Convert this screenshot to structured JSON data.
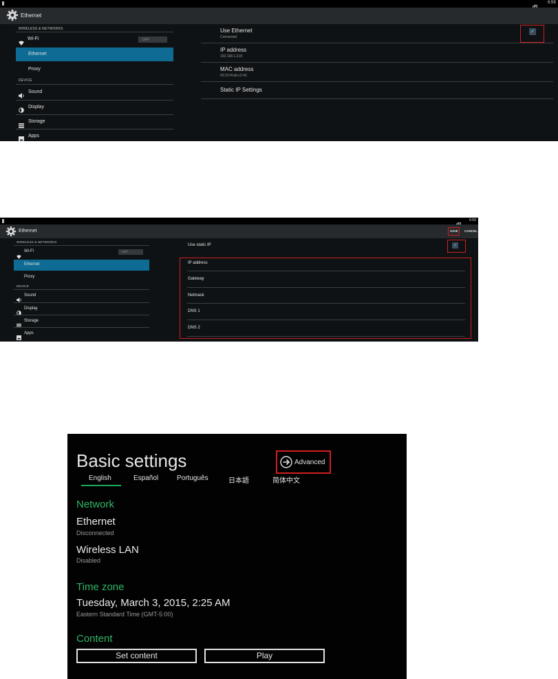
{
  "panel1": {
    "status_time": "6:59",
    "title": "Ethernet",
    "sidebar": {
      "section_wireless": "WIRELESS & NETWORKS",
      "wifi_label": "Wi-Fi",
      "wifi_toggle": "OFF",
      "ethernet_label": "Ethernet",
      "proxy_label": "Proxy",
      "section_device": "DEVICE",
      "sound_label": "Sound",
      "display_label": "Display",
      "storage_label": "Storage",
      "apps_label": "Apps"
    },
    "main": {
      "use_ethernet_title": "Use Ethernet",
      "use_ethernet_summary": "Connected",
      "use_ethernet_checked": true,
      "ip_title": "IP address",
      "ip_value": "192.168.1.218",
      "mac_title": "MAC address",
      "mac_value": "00:22:f4:ab:c2:43",
      "static_title": "Static IP Settings"
    }
  },
  "panel2": {
    "status_time": "6:59",
    "title": "Ethernet",
    "save_label": "SAVE",
    "cancel_label": "CANCEL",
    "sidebar": {
      "section_wireless": "WIRELESS & NETWORKS",
      "wifi_label": "Wi-Fi",
      "wifi_toggle": "OFF",
      "ethernet_label": "Ethernet",
      "proxy_label": "Proxy",
      "section_device": "DEVICE",
      "sound_label": "Sound",
      "display_label": "Display",
      "storage_label": "Storage",
      "apps_label": "Apps"
    },
    "main": {
      "use_static_title": "Use static IP",
      "use_static_checked": true,
      "fields": [
        "IP address",
        "Gateway",
        "Netmask",
        "DNS 1",
        "DNS 2"
      ]
    }
  },
  "panel3": {
    "title": "Basic settings",
    "advanced_label": "Advanced",
    "languages": [
      "English",
      "Español",
      "Português",
      "日本語",
      "简体中文"
    ],
    "selected_language": "English",
    "network_heading": "Network",
    "ethernet_label": "Ethernet",
    "ethernet_status": "Disconnected",
    "wlan_label": "Wireless LAN",
    "wlan_status": "Disabled",
    "timezone_heading": "Time zone",
    "datetime": "Tuesday, March 3, 2015, 2:25 AM",
    "timezone": "Eastern Standard Time (GMT-5:00)",
    "content_heading": "Content",
    "set_content_label": "Set content",
    "play_label": "Play"
  },
  "colors": {
    "selected_nav": "#0e6b94",
    "highlight_box": "#d11f1f",
    "checkbox_tick": "#3aa9f0",
    "section_green": "#2fb767"
  }
}
